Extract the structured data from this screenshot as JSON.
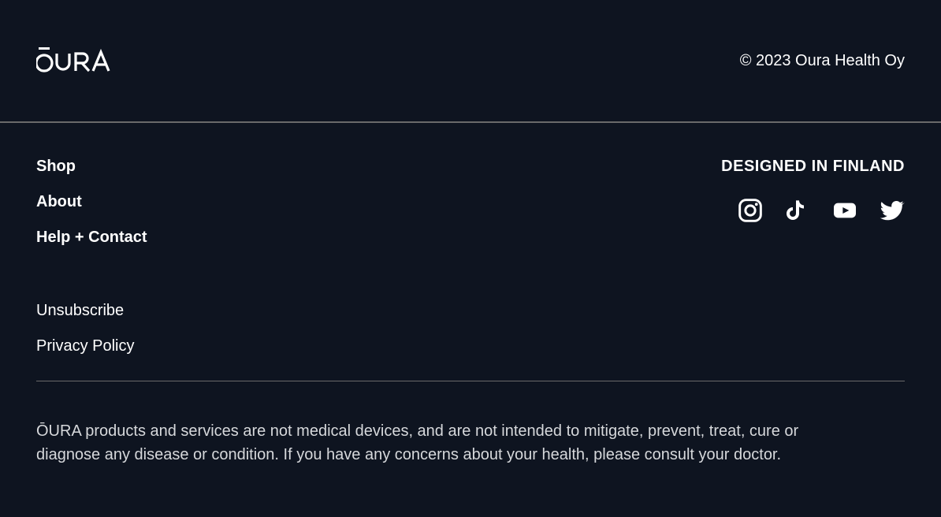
{
  "header": {
    "brand": "ŌURA",
    "copyright": "© 2023 Oura Health Oy"
  },
  "nav": {
    "shop": "Shop",
    "about": "About",
    "help": "Help + Contact"
  },
  "designed_label": "DESIGNED IN FINLAND",
  "socials": {
    "instagram": "instagram",
    "tiktok": "tiktok",
    "youtube": "youtube",
    "twitter": "twitter"
  },
  "legal": {
    "unsubscribe": "Unsubscribe",
    "privacy": "Privacy Policy"
  },
  "disclaimer": "ŌURA products and services are not medical devices, and are not intended to mitigate, prevent, treat, cure or diagnose any disease or condition. If you have any concerns about your health, please consult your doctor."
}
